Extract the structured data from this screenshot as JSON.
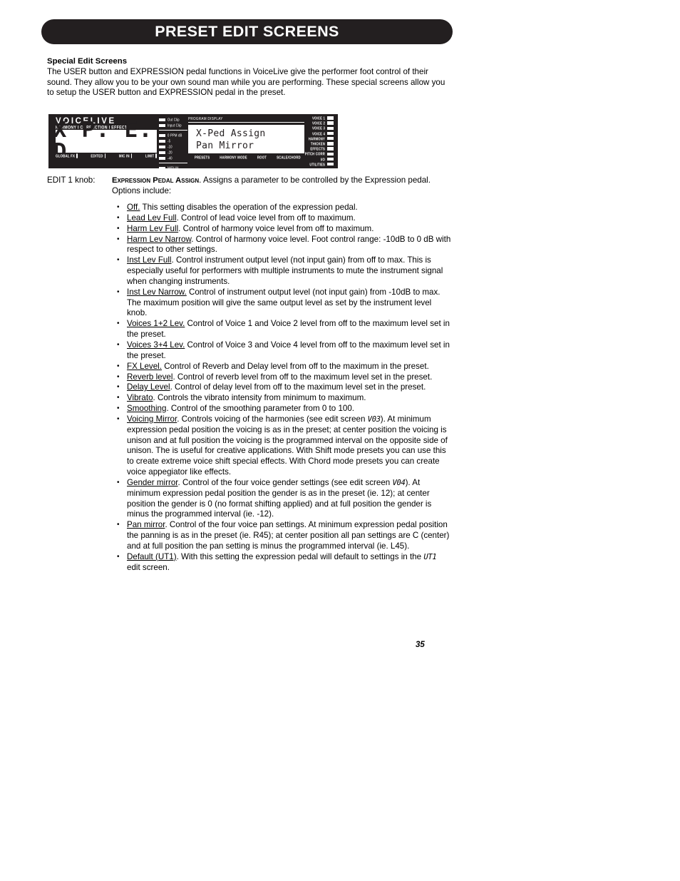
{
  "header": {
    "banner_title": "PRESET EDIT SCREENS"
  },
  "intro": {
    "heading": "Special Edit Screens",
    "body": "The USER button and EXPRESSION pedal functions in VoiceLive give the performer foot control of their sound. They allow you to be your own sound man while you are performing.  These special screens allow you to setup the USER button and EXPRESSION pedal in the preset."
  },
  "device": {
    "brand_name": "VOICELIVE",
    "brand_sub": "HARMONY I CORRECTION I EFFECTS",
    "seg_display": "X P. E. D",
    "status_labels": [
      "GLOBAL FX",
      "EDITED",
      "MIC IN",
      "LIMIT"
    ],
    "meters": {
      "clip": [
        "Out Clip",
        "Input Clip"
      ],
      "scale": [
        "0  PPM dB",
        "-5",
        "-10",
        "-20",
        "-40"
      ],
      "midi": "MIDI IN"
    },
    "program_display": {
      "label": "PROGRAM DISPLAY",
      "line1": "X-Ped Assign",
      "line2": "Pan Mirror",
      "soft_keys": [
        "PRESETS",
        "HARMONY MODE",
        "ROOT",
        "SCALE/CHORD"
      ]
    },
    "right_leds": [
      "VOICE 1",
      "VOICE 2",
      "VOICE 3",
      "VOICE 4",
      "HARMONY",
      "THICKEN",
      "EFFECTS",
      "PITCH CORR",
      "I/O",
      "UTILITIES"
    ]
  },
  "knob": {
    "label": "EDIT 1 knob:",
    "title": "Expression Pedal Assign",
    "description": ".  Assigns a parameter to be controlled by the Expression pedal. Options include:"
  },
  "options": [
    {
      "term": "Off.",
      "rest": " This setting disables the operation of the expression pedal."
    },
    {
      "term": "Lead Lev Full",
      "rest": ". Control of lead voice level from off to maximum."
    },
    {
      "term": "Harm Lev Full",
      "rest": ". Control of harmony voice level from off to maximum."
    },
    {
      "term": "Harm Lev Narrow",
      "rest": ". Control of harmony voice level.  Foot control range: -10dB to 0 dB with respect to other settings."
    },
    {
      "term": "Inst Lev Full",
      "rest": ". Control instrument output level (not input gain) from off to max. This is especially useful for performers with multiple instruments to mute the instrument signal when changing instruments."
    },
    {
      "term": "Inst Lev Narrow.",
      "rest": " Control of instrument output level (not input gain) from -10dB to max.  The maximum position will give the same output level as set by the instrument level knob."
    },
    {
      "term": "Voices 1+2 Lev.",
      "rest": " Control of Voice 1 and Voice 2 level from off to the maximum level set in the preset."
    },
    {
      "term": "Voices 3+4 Lev.",
      "rest": " Control of Voice 3 and Voice 4 level from off to the maximum level set in the preset."
    },
    {
      "term": "FX Level.",
      "rest": " Control of Reverb and Delay level from off to the maximum in the preset."
    },
    {
      "term": "Reverb level",
      "rest": ". Control of reverb level from off to the maximum level set in the preset."
    },
    {
      "term": "Delay Level",
      "rest": ". Control of delay level from off to the maximum level set in the preset."
    },
    {
      "term": "Vibrato",
      "rest": ". Controls the vibrato intensity from minimum to maximum."
    },
    {
      "term": "Smoothing",
      "rest": ". Control of the smoothing parameter from 0 to 100."
    },
    {
      "term": "Voicing Mirror",
      "rest_before": ".  Controls voicing of the harmonies (see edit screen ",
      "screen_ref": "V03",
      "rest_after": "). At minimum expression pedal position the voicing is as in the preset; at center position the voicing is unison and at full position the voicing is the programmed interval on the opposite side of unison. The is useful for creative applications. With Shift mode presets you can use this to create extreme voice shift special effects.  With Chord mode presets you can create voice appegiator like effects."
    },
    {
      "term": "Gender mirror",
      "rest_before": ". Control of the four voice gender settings (see edit screen ",
      "screen_ref": "V04",
      "rest_after": "). At minimum expression pedal position the gender is as in the preset (ie. 12); at center position the gender is 0 (no format shifting applied) and at full position the gender is minus the programmed interval (ie. -12)."
    },
    {
      "term": "Pan mirror",
      "rest": ". Control of the four voice pan settings. At minimum expression pedal position the panning is as in the preset (ie. R45); at center position all pan settings are C (center) and at full position the pan setting is minus the programmed interval (ie. L45)."
    },
    {
      "term": "Default (UT1)",
      "rest_before": ".  With this setting the expression pedal will default to settings in the ",
      "screen_ref": "UT1",
      "rest_after": " edit screen."
    }
  ],
  "footer": {
    "page_number": "35"
  }
}
